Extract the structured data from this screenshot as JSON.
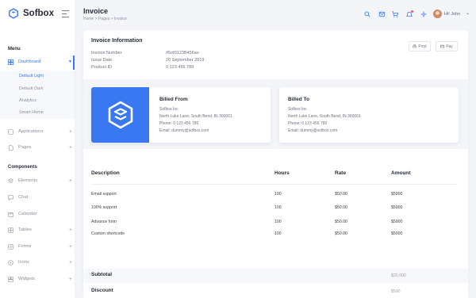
{
  "app": {
    "name": "Sofbox"
  },
  "sidebar": {
    "menu_heading": "Menu",
    "components_heading": "Components",
    "dashboard": {
      "label": "Dashboard"
    },
    "submenu": [
      "Default Light",
      "Default Dark",
      "Analytics",
      "Smart Home"
    ],
    "menu_items": [
      "Applications",
      "Pages"
    ],
    "component_items": [
      "Elements",
      "Chat",
      "Calendar",
      "Tables",
      "Forms",
      "Icons",
      "Widgets"
    ]
  },
  "header": {
    "title": "Invoice",
    "breadcrumb": "Home > Pages > Invoice",
    "user_name": "Hi! John"
  },
  "invoice": {
    "title": "Invoice Information",
    "fields": [
      {
        "label": "Invoice Number",
        "value": "#5of0123B456ax"
      },
      {
        "label": "Issue Date",
        "value": "20 September 2019"
      },
      {
        "label": "Product ID",
        "value": "0 123 456 789"
      }
    ],
    "print_label": "Print",
    "pay_label": "Pay"
  },
  "billed_from": {
    "title": "Billed From",
    "lines": [
      "Sofbox Inc",
      "North Luke Lane, South Bend, IN 360001",
      "Phone: 0 123 456 789",
      "Email: dummy@sofbox.com"
    ]
  },
  "billed_to": {
    "title": "Billed To",
    "lines": [
      "Sofbox Inc",
      "North Luke Lane, South Bend, IN 360001",
      "Phone: 0 123 456 789",
      "Email: dummy@sofbox.com"
    ]
  },
  "table": {
    "headers": [
      "Description",
      "Hours",
      "Rate",
      "Amount"
    ],
    "rows": [
      [
        "Email support",
        "100",
        "$50.00",
        "$5000"
      ],
      [
        "100% support",
        "100",
        "$50.00",
        "$5000"
      ],
      [
        "Advance form",
        "100",
        "$50.00",
        "$5000"
      ],
      [
        "Custom shortcode",
        "100",
        "$50.00",
        "$5000"
      ]
    ]
  },
  "totals": {
    "subtotal_label": "Subtotal",
    "subtotal_value": "$20,000",
    "discount_label": "Discount",
    "discount_value": "$500"
  },
  "colors": {
    "accent": "#3a78f2",
    "notification": "#f0566a"
  },
  "icons": [
    "search-icon",
    "mail-icon",
    "cart-icon",
    "bell-icon",
    "settings-icon",
    "chevron-down-icon"
  ]
}
